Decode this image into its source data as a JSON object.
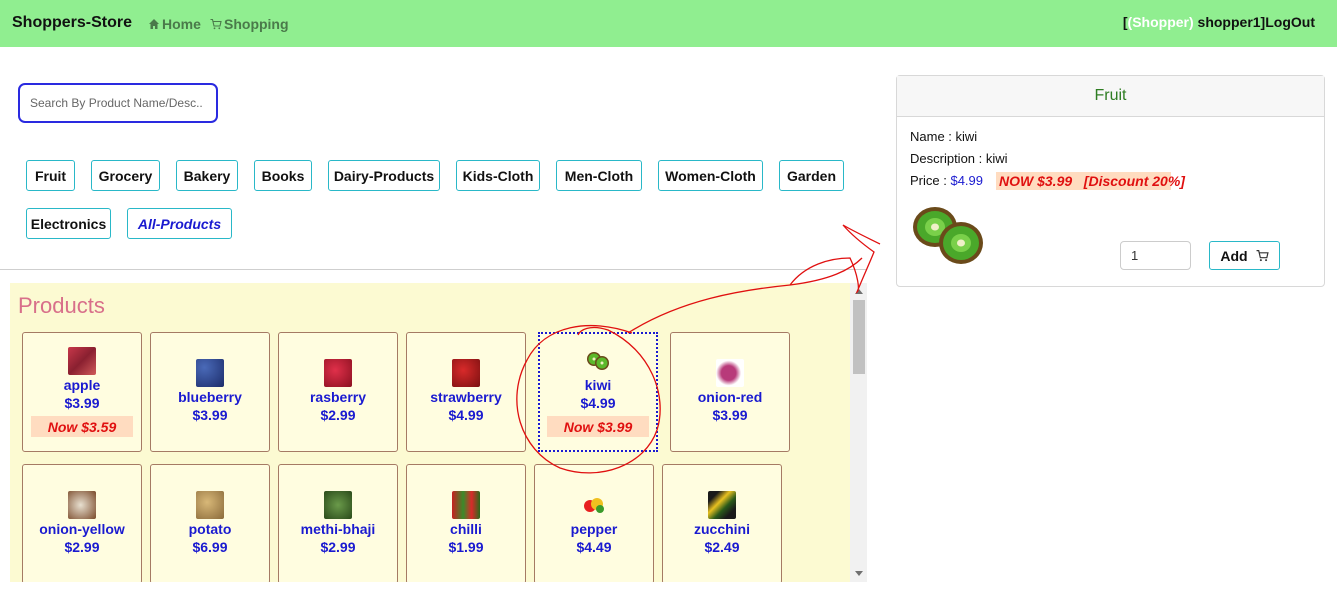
{
  "navbar": {
    "brand": "Shoppers-Store",
    "home": "Home",
    "shopping": "Shopping",
    "user_prefix": "[",
    "user_role": "(Shopper)",
    "user_name": " shopper1]",
    "logout": "LogOut"
  },
  "search": {
    "placeholder": "Search By Product Name/Desc..",
    "value": ""
  },
  "categories": [
    "Fruit",
    "Grocery",
    "Bakery",
    "Books",
    "Dairy-Products",
    "Kids-Cloth",
    "Men-Cloth",
    "Women-Cloth",
    "Garden",
    "Electronics",
    "All-Products"
  ],
  "products_title": "Products",
  "products": [
    {
      "name": "apple",
      "price": "$3.99",
      "now": "Now $3.59"
    },
    {
      "name": "blueberry",
      "price": "$3.99"
    },
    {
      "name": "rasberry",
      "price": "$2.99"
    },
    {
      "name": "strawberry",
      "price": "$4.99"
    },
    {
      "name": "kiwi",
      "price": "$4.99",
      "now": "Now $3.99",
      "selected": true
    },
    {
      "name": "onion-red",
      "price": "$3.99"
    },
    {
      "name": "onion-yellow",
      "price": "$2.99"
    },
    {
      "name": "potato",
      "price": "$6.99"
    },
    {
      "name": "methi-bhaji",
      "price": "$2.99"
    },
    {
      "name": "chilli",
      "price": "$1.99"
    },
    {
      "name": "pepper",
      "price": "$4.49"
    },
    {
      "name": "zucchini",
      "price": "$2.49"
    }
  ],
  "detail": {
    "category": "Fruit",
    "name_label": "Name : ",
    "name": "kiwi",
    "desc_label": "Description : ",
    "desc": "kiwi",
    "price_label": "Price : ",
    "price": "$4.99",
    "discount_text": "NOW $3.99   [Discount 20%]",
    "qty": "1",
    "add_label": "Add"
  },
  "colors": {
    "navbar": "#90ee90",
    "accent_blue": "#1a1ad0",
    "discount_red": "#e01010",
    "panel_bg": "#fcfad2",
    "category_border": "#29b8c8"
  }
}
